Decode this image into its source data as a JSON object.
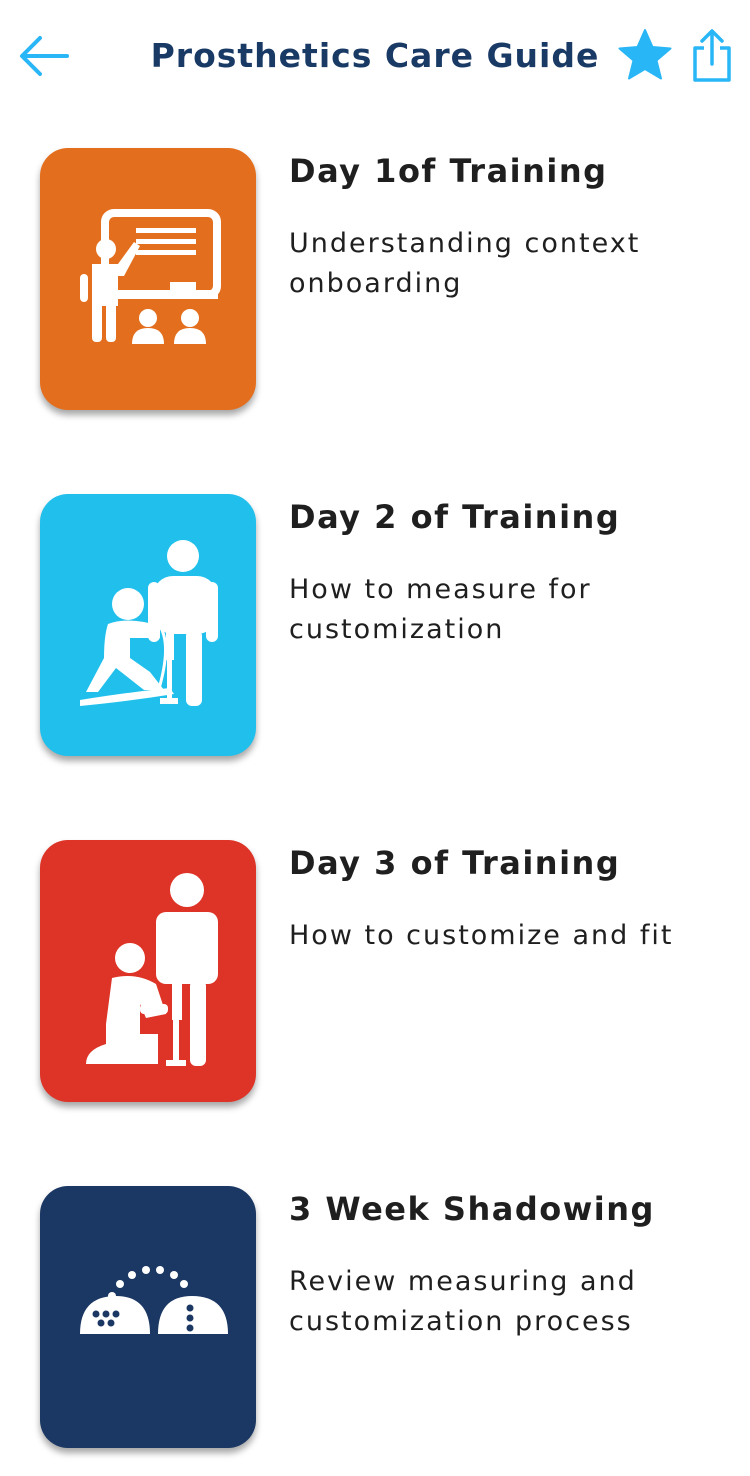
{
  "header": {
    "title": "Prosthetics Care Guide",
    "back_icon": "arrow-left-icon",
    "favorite_icon": "star-icon",
    "share_icon": "share-icon",
    "accent_color": "#29b6f6",
    "title_color": "#1a3a66"
  },
  "modules": [
    {
      "title": "Day 1of Training",
      "description": "Understanding context onboarding",
      "icon": "classroom-icon",
      "color": "#e36f1e"
    },
    {
      "title": "Day 2 of Training",
      "description": "How to measure for customization",
      "icon": "measuring-icon",
      "color": "#21c0ec"
    },
    {
      "title": "Day 3 of Training",
      "description": "How to customize and fit",
      "icon": "fitting-icon",
      "color": "#de3427"
    },
    {
      "title": "3 Week Shadowing",
      "description": "Review measuring and customization process",
      "icon": "shadowing-icon",
      "color": "#1b3763"
    }
  ]
}
